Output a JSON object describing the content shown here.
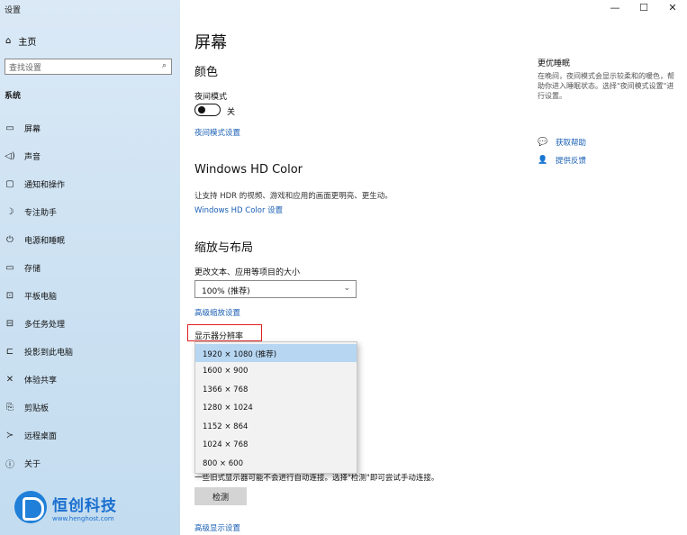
{
  "window": {
    "title": "设置",
    "minimize": "—",
    "maximize": "☐",
    "close": "✕"
  },
  "sidebar": {
    "home": "主页",
    "search_placeholder": "查找设置",
    "section": "系统",
    "items": [
      {
        "label": "屏幕",
        "icon": "monitor-icon",
        "glyph": "▭"
      },
      {
        "label": "声音",
        "icon": "speaker-icon",
        "glyph": "◁)"
      },
      {
        "label": "通知和操作",
        "icon": "notification-icon",
        "glyph": "▢"
      },
      {
        "label": "专注助手",
        "icon": "moon-icon",
        "glyph": "☽"
      },
      {
        "label": "电源和睡眠",
        "icon": "power-icon",
        "glyph": "⏻"
      },
      {
        "label": "存储",
        "icon": "storage-icon",
        "glyph": "▭"
      },
      {
        "label": "平板电脑",
        "icon": "tablet-icon",
        "glyph": "⊡"
      },
      {
        "label": "多任务处理",
        "icon": "multitask-icon",
        "glyph": "⊟"
      },
      {
        "label": "投影到此电脑",
        "icon": "project-icon",
        "glyph": "⊏"
      },
      {
        "label": "体验共享",
        "icon": "share-icon",
        "glyph": "✕"
      },
      {
        "label": "剪贴板",
        "icon": "clipboard-icon",
        "glyph": "⎘"
      },
      {
        "label": "远程桌面",
        "icon": "remote-icon",
        "glyph": "≻"
      },
      {
        "label": "关于",
        "icon": "info-icon",
        "glyph": "ⓘ"
      }
    ]
  },
  "logo": {
    "name": "恒创科技",
    "url_text": "www.henghost.com"
  },
  "main": {
    "title": "屏幕",
    "color_heading": "颜色",
    "night_mode_label": "夜间模式",
    "night_mode_state": "关",
    "night_mode_link": "夜间模式设置",
    "hd_heading": "Windows HD Color",
    "hd_desc": "让支持 HDR 的视频、游戏和应用的画面更明亮、更生动。",
    "hd_link": "Windows HD Color 设置",
    "scale_heading": "缩放与布局",
    "scale_label": "更改文本、应用等项目的大小",
    "scale_value": "100% (推荐)",
    "scale_link": "高级缩放设置",
    "resolution_label": "显示器分辨率",
    "resolution_options": [
      "1920 × 1080 (推荐)",
      "1600 × 900",
      "1366 × 768",
      "1280 × 1024",
      "1152 × 864",
      "1024 × 768",
      "800 × 600"
    ],
    "detect_desc": "一些旧式显示器可能不会进行自动连接。选择\"检测\"即可尝试手动连接。",
    "detect_button": "检测",
    "advanced_link": "高级显示设置"
  },
  "right_panel": {
    "title": "更优睡眠",
    "desc": "在晚间，夜间模式会显示较柔和的暖色，帮助你进入睡眠状态。选择\"夜间模式设置\"进行设置。",
    "help_link": "获取帮助",
    "feedback_link": "提供反馈"
  }
}
